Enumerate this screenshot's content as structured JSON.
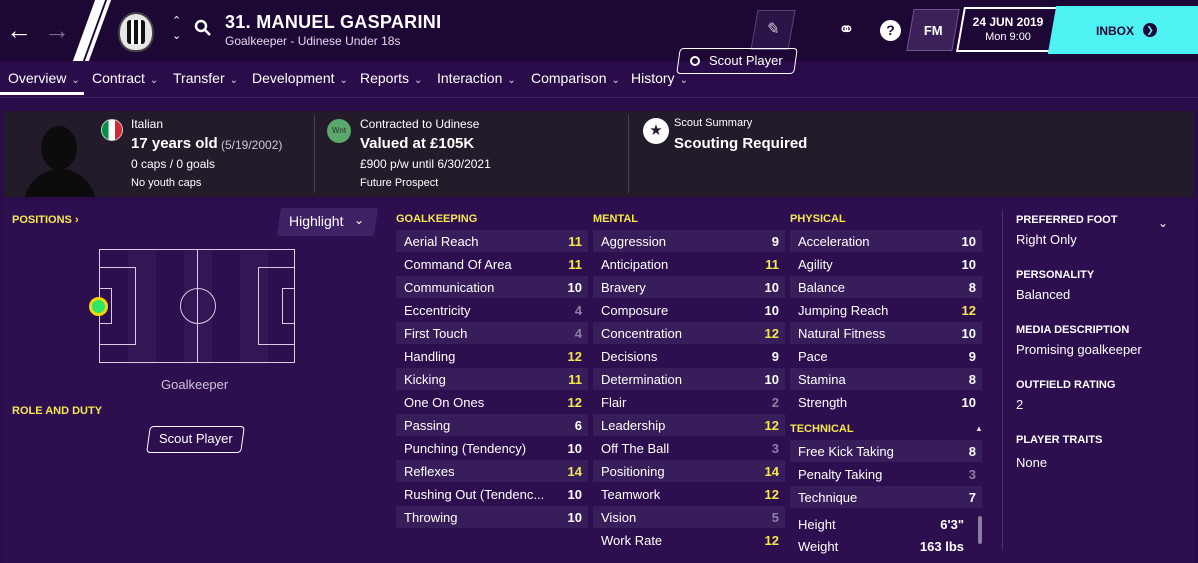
{
  "header": {
    "player_name": "31. MANUEL GASPARINI",
    "player_sub": "Goalkeeper - Udinese Under 18s",
    "date": "24 JUN 2019",
    "time": "Mon 9:00",
    "fm_label": "FM",
    "inbox_label": "INBOX",
    "help_label": "?"
  },
  "tabs": [
    {
      "label": "Overview"
    },
    {
      "label": "Contract"
    },
    {
      "label": "Transfer"
    },
    {
      "label": "Development"
    },
    {
      "label": "Reports"
    },
    {
      "label": "Interaction"
    },
    {
      "label": "Comparison"
    },
    {
      "label": "History"
    }
  ],
  "info": {
    "nationality": "Italian",
    "age": "17 years old",
    "dob": "(5/19/2002)",
    "caps": "0 caps / 0 goals",
    "youth_caps": "No youth caps",
    "status_badge": "Wnt",
    "contract": "Contracted to Udinese",
    "value": "Valued at £105K",
    "wage": "£900 p/w until 6/30/2021",
    "prospect": "Future Prospect",
    "scout_title": "Scout Summary",
    "scout_status": "Scouting Required",
    "scout_button": "Scout Player"
  },
  "positions": {
    "title": "POSITIONS ›",
    "highlight_label": "Highlight",
    "position_label": "Goalkeeper",
    "role_title": "ROLE AND DUTY",
    "role_button": "Scout Player"
  },
  "goalkeeping": {
    "title": "GOALKEEPING",
    "attrs": [
      {
        "name": "Aerial Reach",
        "value": "11"
      },
      {
        "name": "Command Of Area",
        "value": "11"
      },
      {
        "name": "Communication",
        "value": "10"
      },
      {
        "name": "Eccentricity",
        "value": "4"
      },
      {
        "name": "First Touch",
        "value": "4"
      },
      {
        "name": "Handling",
        "value": "12"
      },
      {
        "name": "Kicking",
        "value": "11"
      },
      {
        "name": "One On Ones",
        "value": "12"
      },
      {
        "name": "Passing",
        "value": "6"
      },
      {
        "name": "Punching (Tendency)",
        "value": "10"
      },
      {
        "name": "Reflexes",
        "value": "14"
      },
      {
        "name": "Rushing Out (Tendenc...",
        "value": "10"
      },
      {
        "name": "Throwing",
        "value": "10"
      }
    ]
  },
  "mental": {
    "title": "MENTAL",
    "attrs": [
      {
        "name": "Aggression",
        "value": "9"
      },
      {
        "name": "Anticipation",
        "value": "11"
      },
      {
        "name": "Bravery",
        "value": "10"
      },
      {
        "name": "Composure",
        "value": "10"
      },
      {
        "name": "Concentration",
        "value": "12"
      },
      {
        "name": "Decisions",
        "value": "9"
      },
      {
        "name": "Determination",
        "value": "10"
      },
      {
        "name": "Flair",
        "value": "2"
      },
      {
        "name": "Leadership",
        "value": "12"
      },
      {
        "name": "Off The Ball",
        "value": "3"
      },
      {
        "name": "Positioning",
        "value": "14"
      },
      {
        "name": "Teamwork",
        "value": "12"
      },
      {
        "name": "Vision",
        "value": "5"
      },
      {
        "name": "Work Rate",
        "value": "12"
      }
    ]
  },
  "physical": {
    "title": "PHYSICAL",
    "attrs": [
      {
        "name": "Acceleration",
        "value": "10"
      },
      {
        "name": "Agility",
        "value": "10"
      },
      {
        "name": "Balance",
        "value": "8"
      },
      {
        "name": "Jumping Reach",
        "value": "12"
      },
      {
        "name": "Natural Fitness",
        "value": "10"
      },
      {
        "name": "Pace",
        "value": "9"
      },
      {
        "name": "Stamina",
        "value": "8"
      },
      {
        "name": "Strength",
        "value": "10"
      }
    ]
  },
  "technical": {
    "title": "TECHNICAL",
    "attrs": [
      {
        "name": "Free Kick Taking",
        "value": "8"
      },
      {
        "name": "Penalty Taking",
        "value": "3"
      },
      {
        "name": "Technique",
        "value": "7"
      }
    ]
  },
  "measurements": {
    "height_label": "Height",
    "height_value": "6'3\"",
    "weight_label": "Weight",
    "weight_value": "163 lbs"
  },
  "profile": {
    "preferred_foot_title": "PREFERRED FOOT",
    "preferred_foot": "Right Only",
    "personality_title": "PERSONALITY",
    "personality": "Balanced",
    "media_title": "MEDIA DESCRIPTION",
    "media": "Promising goalkeeper",
    "outfield_title": "OUTFIELD RATING",
    "outfield": "2",
    "traits_title": "PLAYER TRAITS",
    "traits": "None"
  },
  "colors": {
    "accent_yellow": "#f5e74c",
    "inbox_cyan": "#4ff2f2",
    "background": "#2a0c4a"
  }
}
